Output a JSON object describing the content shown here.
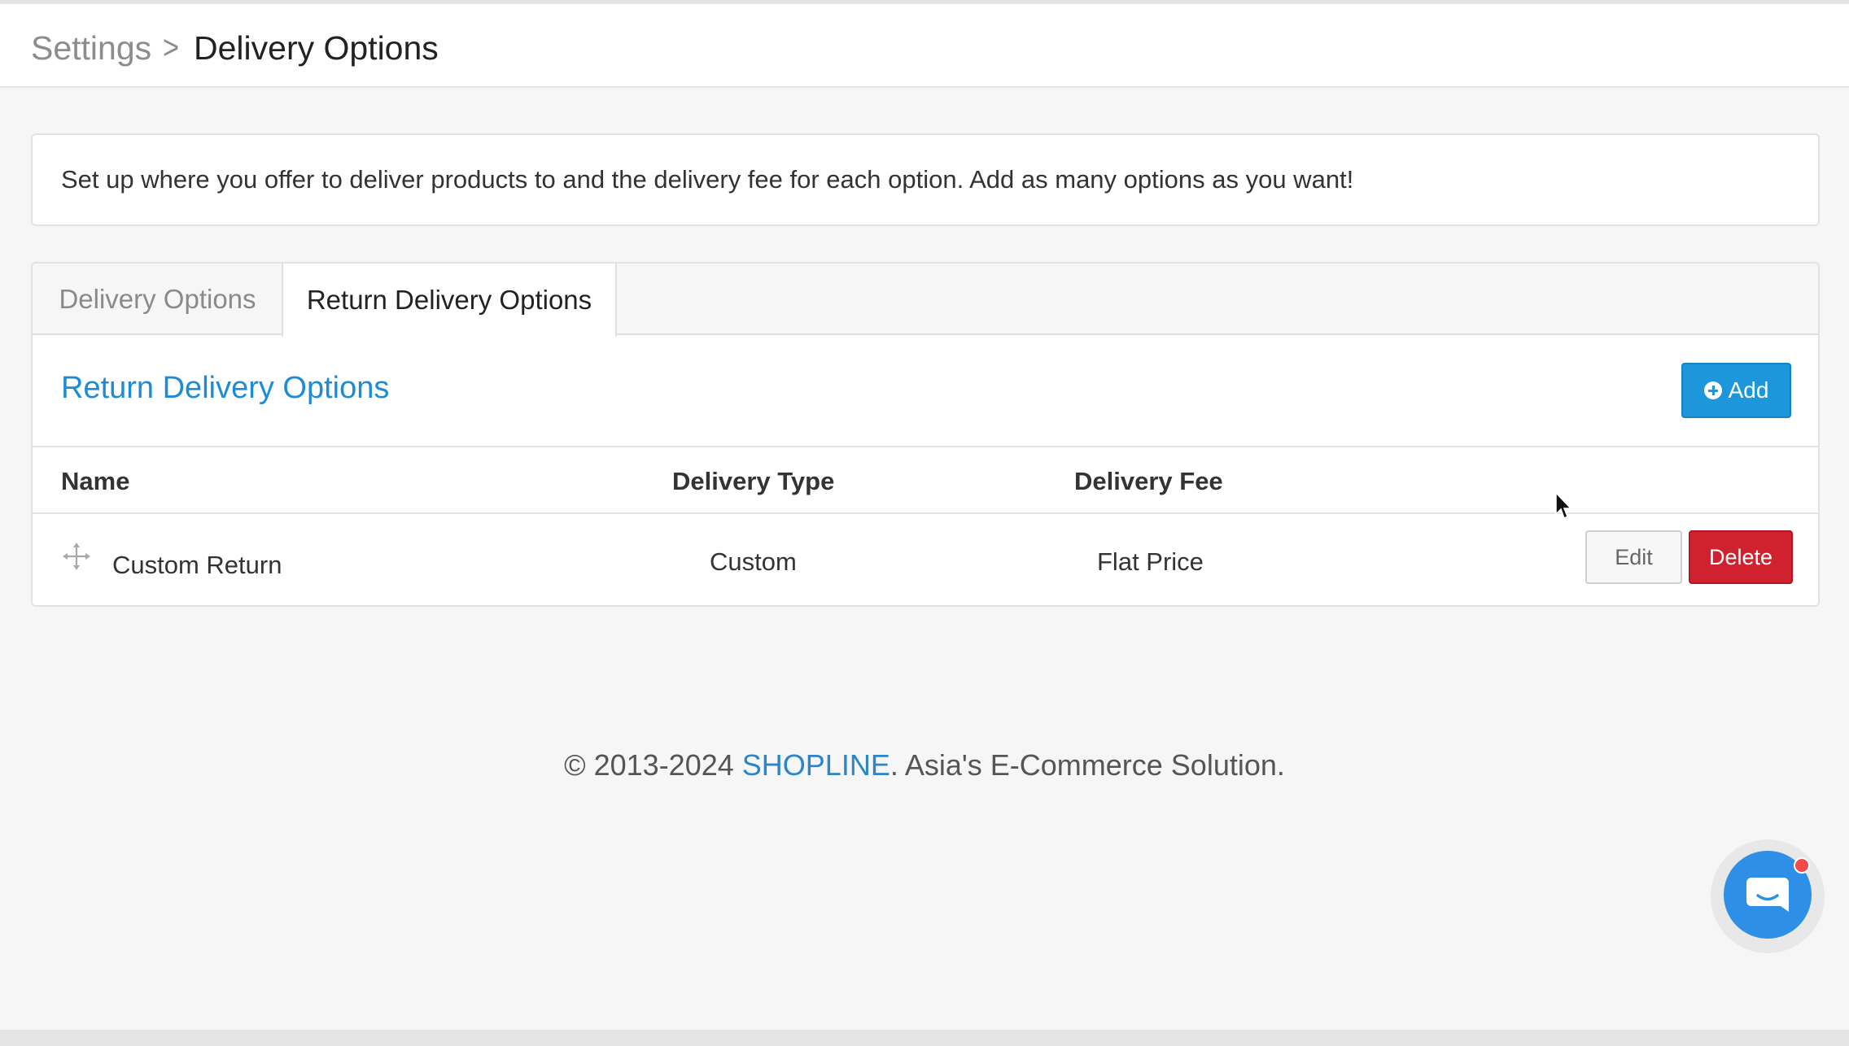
{
  "breadcrumb": {
    "root": "Settings",
    "separator": ">",
    "current": "Delivery Options"
  },
  "info": {
    "text": "Set up where you offer to deliver products to and the delivery fee for each option. Add as many options as you want!"
  },
  "tabs": [
    {
      "label": "Delivery Options",
      "active": false
    },
    {
      "label": "Return Delivery Options",
      "active": true
    }
  ],
  "section": {
    "title": "Return Delivery Options",
    "add_label": "Add"
  },
  "table": {
    "headers": {
      "name": "Name",
      "type": "Delivery Type",
      "fee": "Delivery Fee"
    },
    "rows": [
      {
        "name": "Custom Return",
        "type": "Custom",
        "fee": "Flat Price",
        "edit_label": "Edit",
        "delete_label": "Delete"
      }
    ]
  },
  "footer": {
    "prefix": "© 2013-2024 ",
    "brand": "SHOPLINE",
    "suffix": ". Asia's E-Commerce Solution."
  },
  "colors": {
    "accent": "#1e96db",
    "danger": "#d0222e",
    "link": "#2a86c9",
    "chat": "#2d90e6"
  },
  "icons": [
    "plus-circle-icon",
    "drag-move-icon",
    "chat-icon",
    "mouse-cursor-icon"
  ]
}
